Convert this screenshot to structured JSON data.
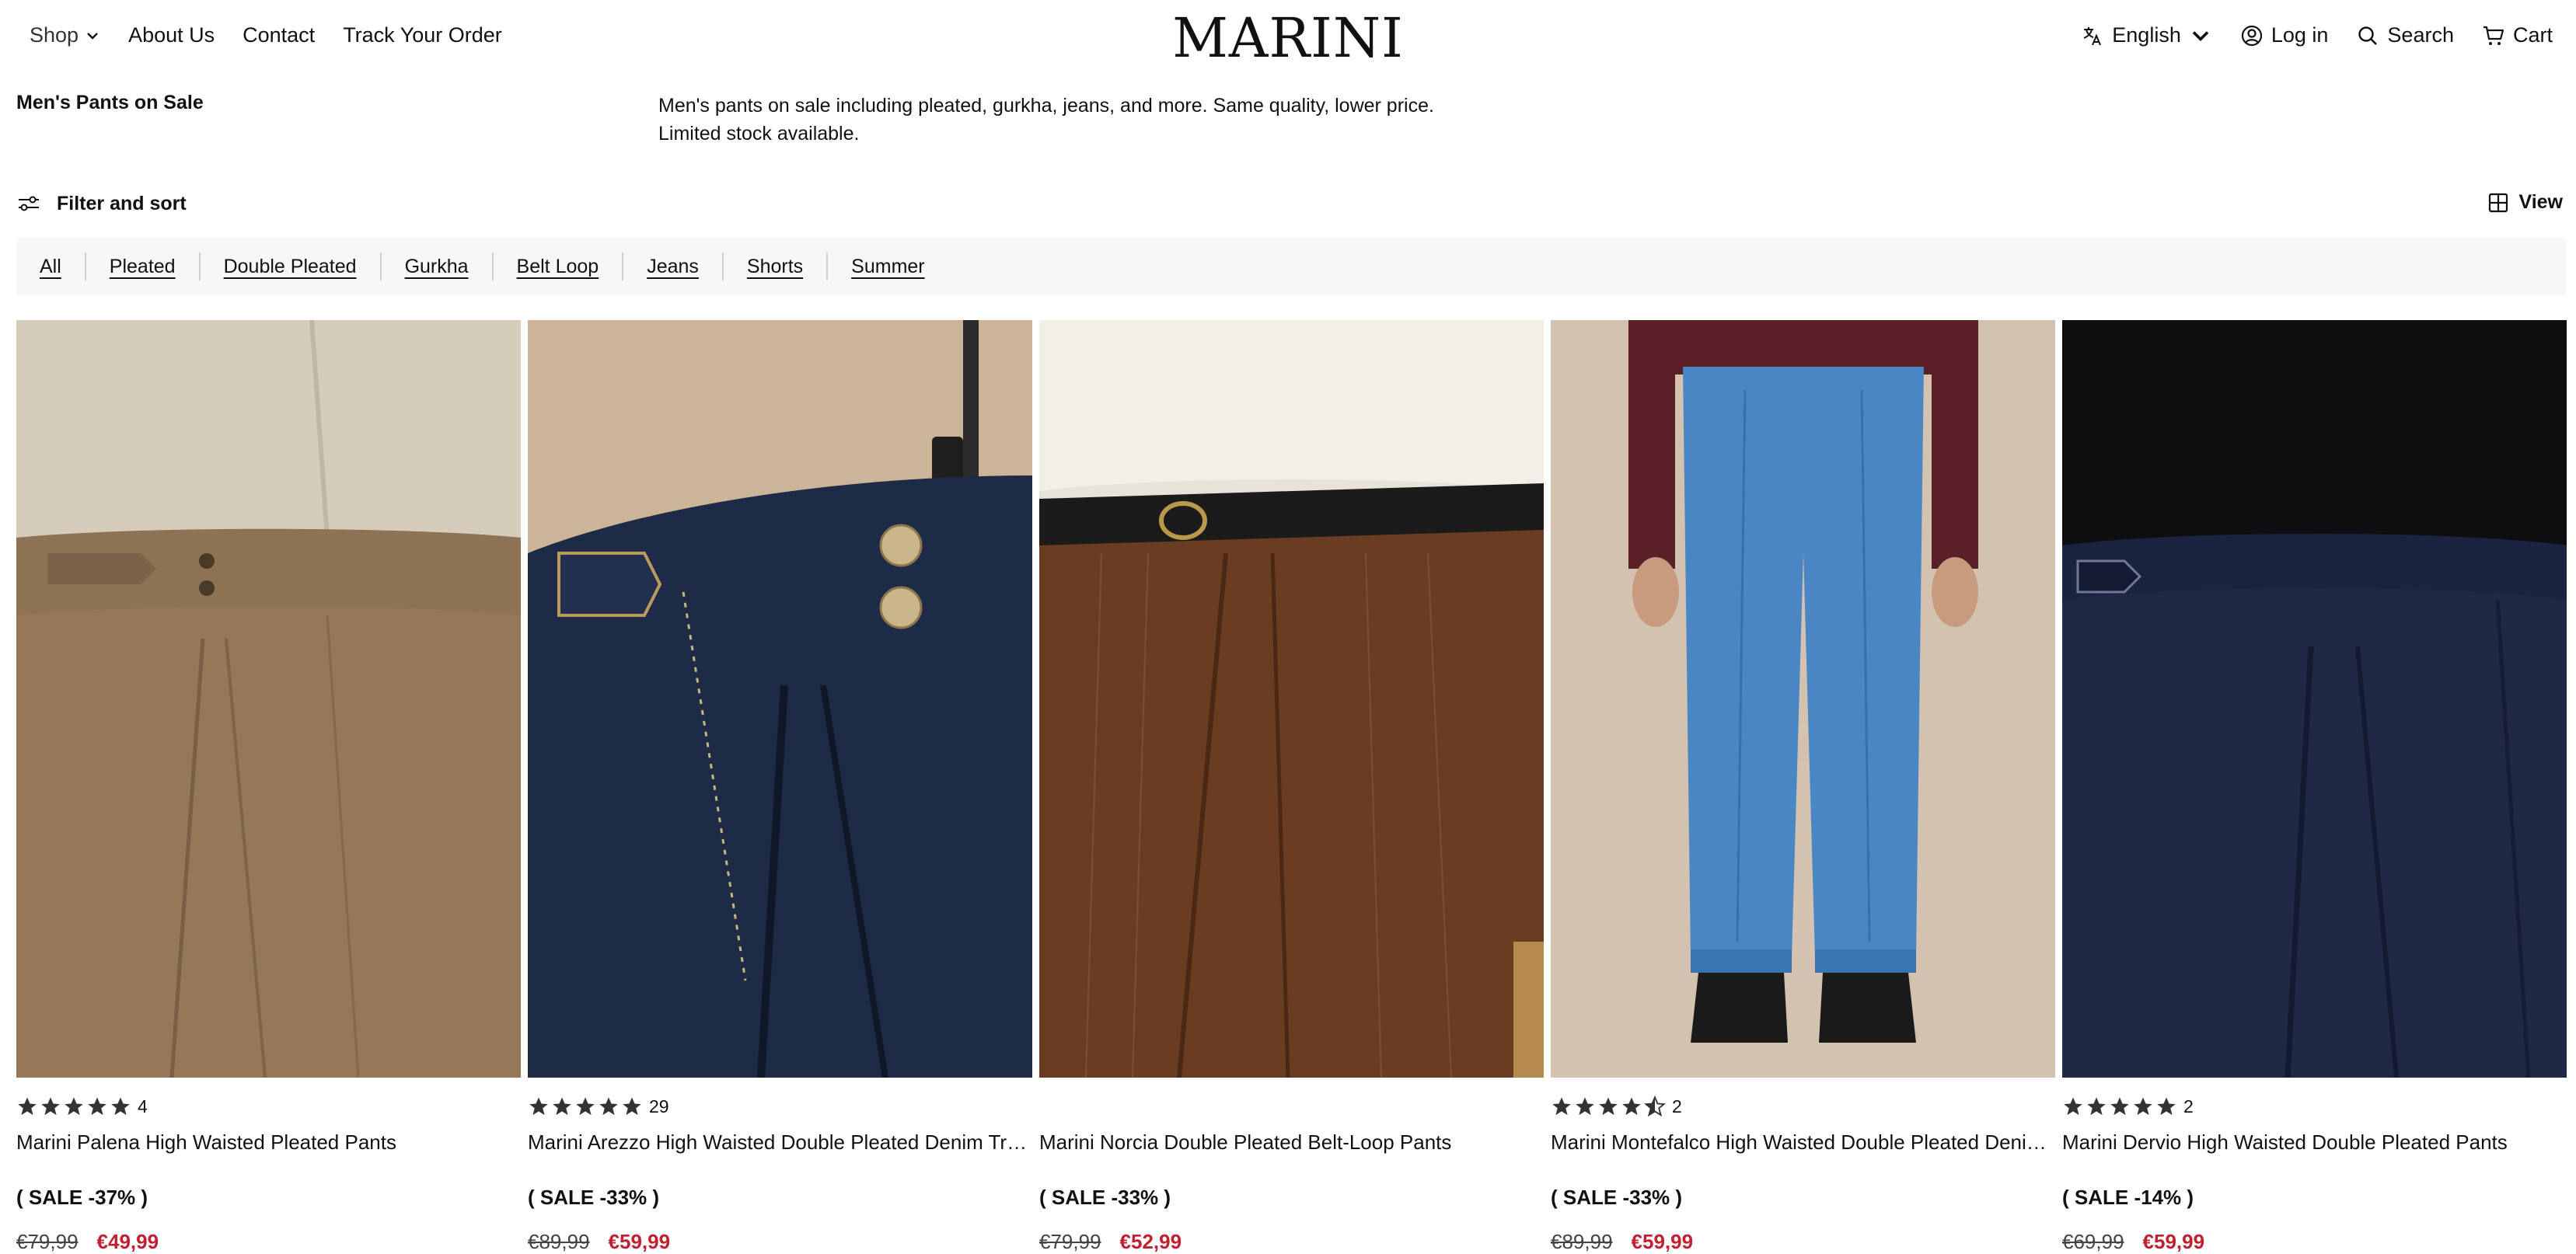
{
  "header": {
    "nav_left": {
      "shop": "Shop",
      "about": "About Us",
      "contact": "Contact",
      "track": "Track Your Order"
    },
    "logo": "MARINI",
    "nav_right": {
      "language": "English",
      "login": "Log in",
      "search": "Search",
      "cart": "Cart"
    }
  },
  "collection": {
    "title": "Men's Pants on Sale",
    "description_line1": "Men's pants on sale including pleated, gurkha, jeans, and more. Same quality, lower price.",
    "description_line2": "Limited stock available."
  },
  "toolbar": {
    "filter_label": "Filter and sort",
    "view_label": "View"
  },
  "tabs": [
    "All",
    "Pleated",
    "Double Pleated",
    "Gurkha",
    "Belt Loop",
    "Jeans",
    "Shorts",
    "Summer"
  ],
  "products": [
    {
      "name": "Marini Palena High Waisted Pleated Pants",
      "rating": 5,
      "review_count": "4",
      "sale": "( SALE -37% )",
      "old_price": "€79,99",
      "new_price": "€49,99",
      "image_desc": "tan-pleated-pants-photo",
      "colors": {
        "bg": "#9f8264",
        "top": "#d8cdbd",
        "pants": "#8c6f53"
      }
    },
    {
      "name": "Marini Arezzo High Waisted Double Pleated Denim Trou...",
      "rating": 5,
      "review_count": "29",
      "sale": "( SALE -33% )",
      "old_price": "€89,99",
      "new_price": "€59,99",
      "image_desc": "dark-denim-trousers-photo",
      "colors": {
        "bg": "#cdb59a",
        "pants": "#1c2a44"
      }
    },
    {
      "name": "Marini Norcia Double Pleated Belt-Loop Pants",
      "rating": 0,
      "review_count": "",
      "sale": "( SALE -33% )",
      "old_price": "€79,99",
      "new_price": "€52,99",
      "image_desc": "brown-pinstripe-pants-photo",
      "colors": {
        "bg": "#e9e4dc",
        "pants": "#6b3e23",
        "belt": "#1c1c1c"
      }
    },
    {
      "name": "Marini Montefalco High Waisted Double Pleated Denim ...",
      "rating": 4.5,
      "review_count": "2",
      "sale": "( SALE -33% )",
      "old_price": "€89,99",
      "new_price": "€59,99",
      "image_desc": "light-blue-denim-pants-photo",
      "colors": {
        "bg": "#d3c2b0",
        "pants": "#4a86c4",
        "top": "#5a1f27"
      }
    },
    {
      "name": "Marini Dervio High Waisted Double Pleated Pants",
      "rating": 5,
      "review_count": "2",
      "sale": "( SALE -14% )",
      "old_price": "€69,99",
      "new_price": "€59,99",
      "image_desc": "navy-pleated-pants-photo",
      "colors": {
        "bg": "#1b2238",
        "pants": "#1f2845",
        "top": "#0e0e10"
      }
    }
  ]
}
